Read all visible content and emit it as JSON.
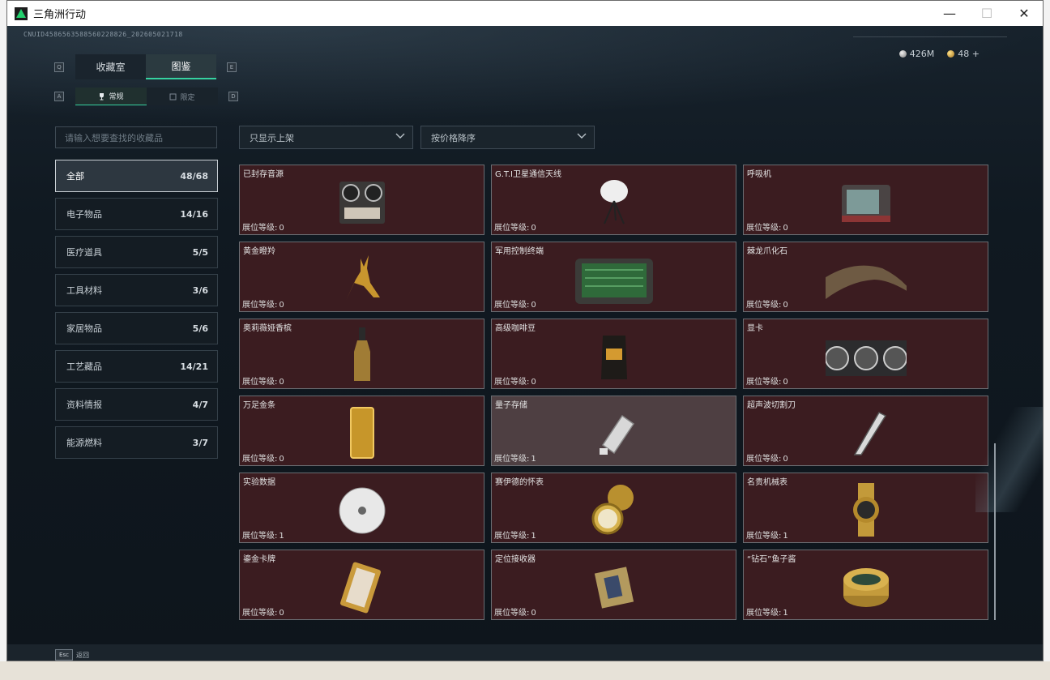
{
  "window": {
    "title": "三角洲行动",
    "minimize": "—",
    "maximize": "☐",
    "close": "✕"
  },
  "uid": "CNUID4586563588560228826_202605021718",
  "currency": {
    "silver": "426M",
    "gold": "48",
    "add": "+"
  },
  "keys": {
    "left_tab": "Q",
    "right_tab": "E",
    "left_sub": "A",
    "right_sub": "D"
  },
  "tabs": [
    {
      "label": "收藏室"
    },
    {
      "label": "图鉴"
    }
  ],
  "subtabs": [
    {
      "label": "常规"
    },
    {
      "label": "限定"
    }
  ],
  "search": {
    "placeholder": "请输入想要查找的收藏品"
  },
  "filters": {
    "shelf": "只显示上架",
    "sort": "按价格降序"
  },
  "categories": [
    {
      "label": "全部",
      "count": "48/68"
    },
    {
      "label": "电子物品",
      "count": "14/16"
    },
    {
      "label": "医疗道具",
      "count": "5/5"
    },
    {
      "label": "工具材料",
      "count": "3/6"
    },
    {
      "label": "家居物品",
      "count": "5/6"
    },
    {
      "label": "工艺藏品",
      "count": "14/21"
    },
    {
      "label": "资料情报",
      "count": "4/7"
    },
    {
      "label": "能源燃料",
      "count": "3/7"
    }
  ],
  "level_label": "展位等级:",
  "items": [
    {
      "name": "已封存音源",
      "level": "0",
      "icon": "tape-recorder-icon"
    },
    {
      "name": "G.T.I卫星通信天线",
      "level": "0",
      "icon": "satellite-dish-icon"
    },
    {
      "name": "呼吸机",
      "level": "0",
      "icon": "ventilator-icon"
    },
    {
      "name": "黄金瞪羚",
      "level": "0",
      "icon": "golden-gazelle-icon"
    },
    {
      "name": "军用控制终端",
      "level": "0",
      "icon": "control-terminal-icon"
    },
    {
      "name": "棘龙爪化石",
      "level": "0",
      "icon": "claw-fossil-icon"
    },
    {
      "name": "奥莉薇娅香槟",
      "level": "0",
      "icon": "champagne-icon"
    },
    {
      "name": "高级咖啡豆",
      "level": "0",
      "icon": "coffee-bag-icon"
    },
    {
      "name": "显卡",
      "level": "0",
      "icon": "graphics-card-icon"
    },
    {
      "name": "万足金条",
      "level": "0",
      "icon": "gold-bar-icon"
    },
    {
      "name": "量子存储",
      "level": "1",
      "icon": "quantum-storage-icon"
    },
    {
      "name": "超声波切割刀",
      "level": "0",
      "icon": "ultrasonic-cutter-icon"
    },
    {
      "name": "实验数据",
      "level": "1",
      "icon": "data-disc-icon"
    },
    {
      "name": "赛伊德的怀表",
      "level": "1",
      "icon": "pocket-watch-icon"
    },
    {
      "name": "名贵机械表",
      "level": "1",
      "icon": "wristwatch-icon"
    },
    {
      "name": "鎏金卡牌",
      "level": "0",
      "icon": "gilded-card-icon"
    },
    {
      "name": "定位接收器",
      "level": "0",
      "icon": "gps-receiver-icon"
    },
    {
      "name": "“钻石”鱼子酱",
      "level": "1",
      "icon": "caviar-tin-icon"
    }
  ],
  "footer": {
    "esc_key": "Esc",
    "back_label": "返回"
  }
}
